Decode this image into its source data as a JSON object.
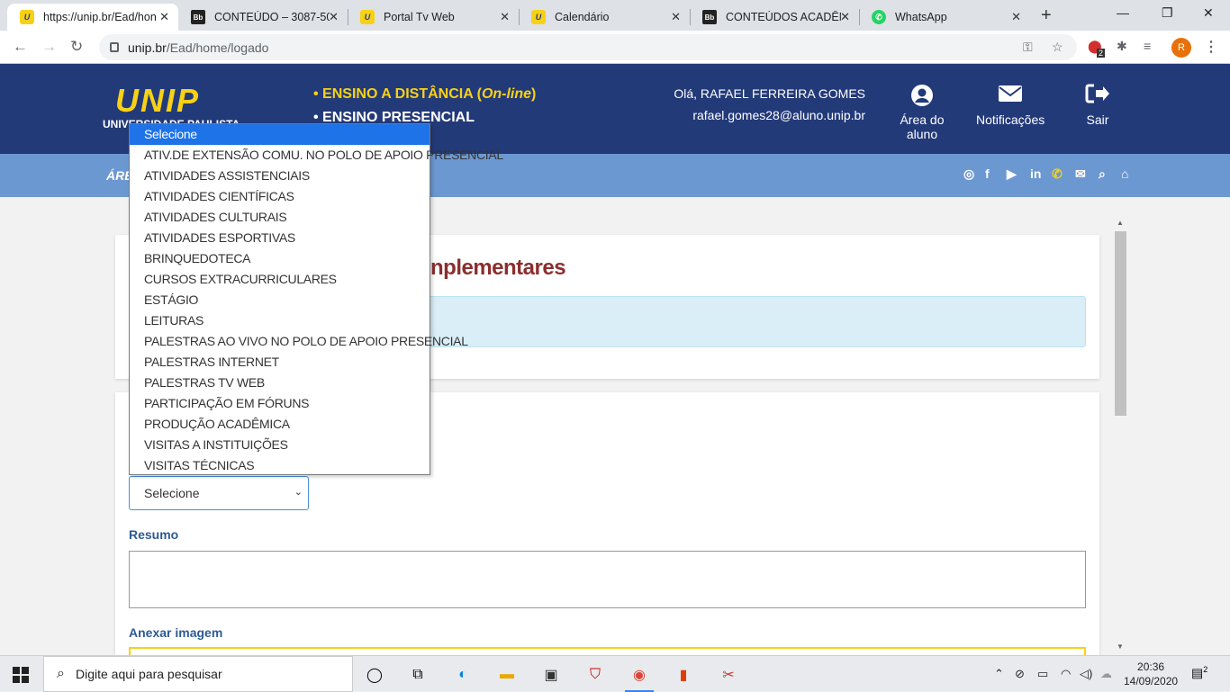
{
  "browser": {
    "tabs": [
      {
        "title": "https://unip.br/Ead/hon",
        "icon": "unip-favicon",
        "active": true
      },
      {
        "title": "CONTEÚDO – 3087-50_",
        "icon": "blackboard-favicon",
        "active": false
      },
      {
        "title": "Portal Tv Web",
        "icon": "unip-favicon",
        "active": false
      },
      {
        "title": "Calendário",
        "icon": "unip-favicon",
        "active": false
      },
      {
        "title": "CONTEÚDOS ACADÊMI",
        "icon": "blackboard-favicon",
        "active": false
      },
      {
        "title": "WhatsApp",
        "icon": "whatsapp-favicon",
        "active": false
      }
    ],
    "url_domain": "unip.br",
    "url_path": "/Ead/home/logado",
    "profile_initial": "R",
    "ext_badge": "2"
  },
  "header": {
    "logo": "UNIP",
    "logo_sub": "UNIVERSIDADE PAULISTA",
    "mode1_prefix": "• ENSINO A DISTÂNCIA (",
    "mode1_em": "On-line",
    "mode1_suffix": ")",
    "mode2": "• ENSINO PRESENCIAL",
    "greeting": "Olá, RAFAEL FERREIRA GOMES",
    "email": "rafael.gomes28@aluno.unip.br",
    "student_area": "Área do aluno",
    "notifications": "Notificações",
    "logout": "Sair"
  },
  "subbar": {
    "label": "ÁREA"
  },
  "page": {
    "title_fragment": "nplementares",
    "select_value": "Selecione",
    "resumo_label": "Resumo",
    "anexar_label": "Anexar imagem"
  },
  "dropdown": {
    "options": [
      "Selecione",
      "ATIV.DE EXTENSÃO COMU. NO POLO DE APOIO PRESENCIAL",
      "ATIVIDADES ASSISTENCIAIS",
      "ATIVIDADES CIENTÍFICAS",
      "ATIVIDADES CULTURAIS",
      "ATIVIDADES ESPORTIVAS",
      "BRINQUEDOTECA",
      "CURSOS EXTRACURRICULARES",
      "ESTÁGIO",
      "LEITURAS",
      "PALESTRAS AO VIVO NO POLO DE APOIO PRESENCIAL",
      "PALESTRAS INTERNET",
      "PALESTRAS TV WEB",
      "PARTICIPAÇÃO EM FÓRUNS",
      "PRODUÇÃO ACADÊMICA",
      "VISITAS A INSTITUIÇÕES",
      "VISITAS TÉCNICAS"
    ],
    "selected_index": 0
  },
  "taskbar": {
    "search_placeholder": "Digite aqui para pesquisar",
    "time": "20:36",
    "date": "14/09/2020",
    "notif_count": "2"
  },
  "colors": {
    "brand_blue": "#233a79",
    "brand_yellow": "#f7d117",
    "subbar": "#6c98d2",
    "title_red": "#8b2e2e"
  }
}
